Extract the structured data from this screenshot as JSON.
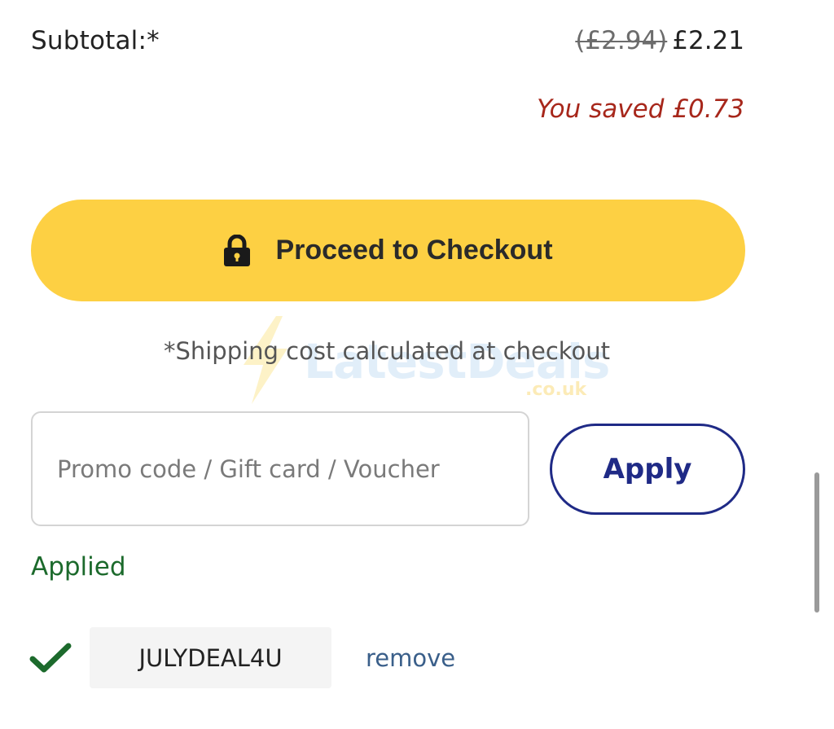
{
  "summary": {
    "subtotal_label": "Subtotal:*",
    "original_price": "(£2.94)",
    "current_price": "£2.21",
    "savings_text": "You saved £0.73"
  },
  "checkout": {
    "button_label": "Proceed to Checkout",
    "icon": "lock-icon",
    "shipping_note": "*Shipping cost calculated at checkout"
  },
  "watermark": {
    "text": "LatestDeals",
    "sub": ".co.uk"
  },
  "promo": {
    "placeholder": "Promo code / Gift card / Voucher",
    "value": "",
    "apply_label": "Apply",
    "applied_label": "Applied",
    "applied_code": "JULYDEAL4U",
    "remove_label": "remove",
    "icon": "checkmark-icon"
  },
  "colors": {
    "checkout_button": "#fdd043",
    "savings_text": "#a7271b",
    "apply_border": "#1f2a86",
    "applied_green": "#1c6a2c",
    "remove_link": "#3a5f8a"
  }
}
